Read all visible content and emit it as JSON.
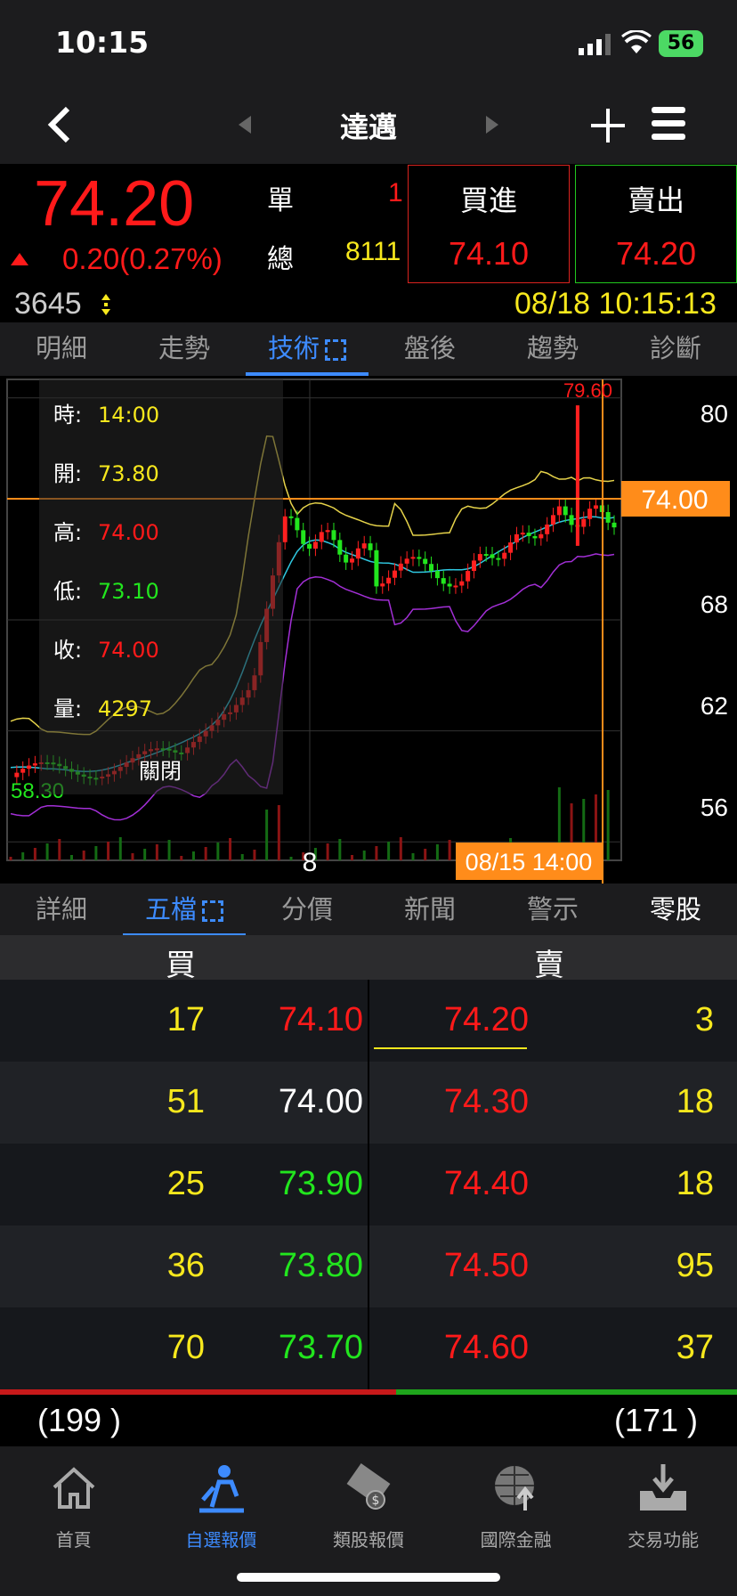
{
  "status": {
    "time": "10:15",
    "battery": "56"
  },
  "nav": {
    "title": "達邁"
  },
  "quote": {
    "last_price": "74.20",
    "change": "0.20",
    "change_pct": "(0.27%)",
    "unit_label": "單",
    "unit_value": "1",
    "total_label": "總",
    "total_value": "8111",
    "buy_label": "買進",
    "buy_price": "74.10",
    "sell_label": "賣出",
    "sell_price": "74.20",
    "count": "3645",
    "datetime": "08/18 10:15:13",
    "colors": {
      "up": "#ff1a1a",
      "down": "#22e61e",
      "accent": "#3d8bff"
    }
  },
  "top_tabs": [
    "明細",
    "走勢",
    "技術",
    "盤後",
    "趨勢",
    "診斷"
  ],
  "chart_data": {
    "type": "candlestick",
    "y_ticks": [
      "80",
      "74.00",
      "68",
      "62",
      "56"
    ],
    "x_tick": "8",
    "high_label": "79.60",
    "low_label": "58.30",
    "current_price": "74.00",
    "cursor_time": "08/15 14:00",
    "ylim": [
      55,
      81
    ],
    "info": {
      "time_label": "時:",
      "time": "14:00",
      "open_label": "開:",
      "open": "73.80",
      "high_label": "高:",
      "high": "74.00",
      "low_label": "低:",
      "low": "73.10",
      "close_label": "收:",
      "close": "74.00",
      "vol_label": "量:",
      "vol": "4297"
    },
    "close_button": "關閉"
  },
  "sub_tabs": [
    "詳細",
    "五檔",
    "分價",
    "新聞",
    "警示",
    "零股"
  ],
  "book": {
    "buy_header": "買",
    "sell_header": "賣",
    "rows": [
      {
        "bid_qty": "17",
        "bid": "74.10",
        "ask": "74.20",
        "ask_qty": "3"
      },
      {
        "bid_qty": "51",
        "bid": "74.00",
        "ask": "74.30",
        "ask_qty": "18"
      },
      {
        "bid_qty": "25",
        "bid": "73.90",
        "ask": "74.40",
        "ask_qty": "18"
      },
      {
        "bid_qty": "36",
        "bid": "73.80",
        "ask": "74.50",
        "ask_qty": "95"
      },
      {
        "bid_qty": "70",
        "bid": "73.70",
        "ask": "74.60",
        "ask_qty": "37"
      }
    ],
    "bid_total": "(199 )",
    "ask_total": "(171 )",
    "bid_share": 0.538
  },
  "bottom_nav": [
    "首頁",
    "自選報價",
    "類股報價",
    "國際金融",
    "交易功能"
  ]
}
